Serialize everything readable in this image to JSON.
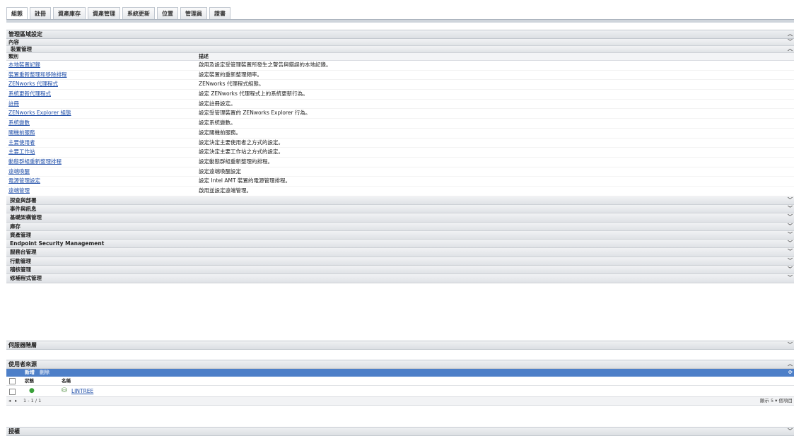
{
  "tabs": [
    "組態",
    "註冊",
    "資產庫存",
    "資產管理",
    "系統更新",
    "位置",
    "管理員",
    "證書"
  ],
  "admin_panel": {
    "title": "管理區域設定",
    "content_label": "內容",
    "device_mgmt_label": "裝置管理",
    "col_category": "類別",
    "col_description": "描述",
    "rows": [
      {
        "name": "本地裝置記錄",
        "desc": "啟用及設定受管理裝置所發生之警告與錯誤的本地記錄。"
      },
      {
        "name": "裝置重新整理和移除排程",
        "desc": "設定裝置的重新整理頻率。"
      },
      {
        "name": "ZENworks 代理程式",
        "desc": "ZENworks 代理程式組態。"
      },
      {
        "name": "系統更新代理程式",
        "desc": "設定 ZENworks 代理程式上的系統更新行為。"
      },
      {
        "name": "註冊",
        "desc": "設定註冊設定。"
      },
      {
        "name": "ZENworks Explorer 組態",
        "desc": "設定受管理裝置的 ZENworks Explorer 行為。"
      },
      {
        "name": "系統變數",
        "desc": "設定系統變數。"
      },
      {
        "name": "關機前服務",
        "desc": "設定關機前服務。"
      },
      {
        "name": "主要使用者",
        "desc": "設定決定主要使用者之方式的設定。"
      },
      {
        "name": "主要工作站",
        "desc": "設定決定主要工作站之方式的設定。"
      },
      {
        "name": "動態群組重新整理排程",
        "desc": "設定動態群組重新整理的排程。"
      },
      {
        "name": "遠端喚醒",
        "desc": "設定遠端喚醒設定"
      },
      {
        "name": "電源管理設定",
        "desc": "設定 Intel AMT 裝置的電源管理排程。"
      },
      {
        "name": "遠端管理",
        "desc": "啟用並設定遠端管理。"
      }
    ],
    "categories": [
      "探查與部署",
      "事件與訊息",
      "基礎架構管理",
      "庫存",
      "資產管理",
      "Endpoint Security Management",
      "服務台管理",
      "行動管理",
      "稽核管理",
      "修補程式管理"
    ]
  },
  "server_panel": {
    "title": "伺服器階層"
  },
  "user_source_panel": {
    "title": "使用者來源",
    "new_label": "新增",
    "delete_label": "刪除",
    "col_status": "狀態",
    "col_name": "名稱",
    "rows": [
      {
        "name": "LINTREE"
      }
    ],
    "pager_text": "1 - 1 / 1",
    "page_size_text": "顯示 5 ▾ 個項目"
  },
  "auth_panel": {
    "title": "授權"
  },
  "colors": {
    "link": "#1f4ea8",
    "toolbar": "#4d7fc8",
    "status_ok": "#3aa13a"
  }
}
